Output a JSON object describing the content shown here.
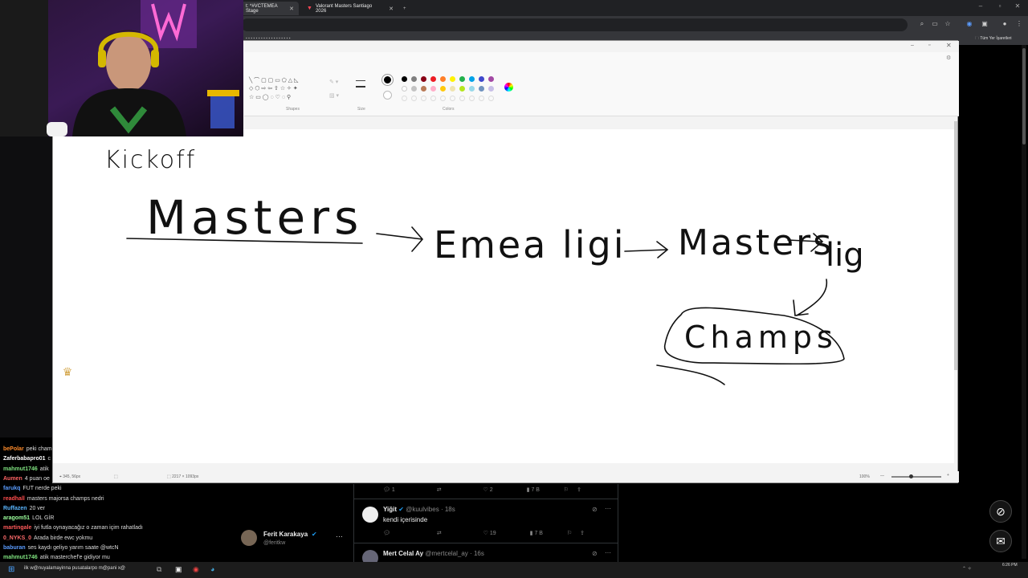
{
  "browser": {
    "tabs": [
      {
        "label": "t: *#VCTEMEA Stage",
        "active": true
      },
      {
        "label": "Valorant Masters Santiago 2026",
        "active": false
      }
    ],
    "bookmarks_right": "Tüm Yer İşaretleri"
  },
  "paint": {
    "ribbon_labels": {
      "shapes": "Shapes",
      "size": "Size",
      "colors": "Colors"
    },
    "status": {
      "cursor": "345, 56px",
      "canvas_size": "2217 × 1093px",
      "zoom": "100%"
    },
    "colors_row1": [
      "#000000",
      "#7f7f7f",
      "#880015",
      "#ed1c24",
      "#ff7f27",
      "#fff200",
      "#22b14c",
      "#00a2e8",
      "#3f48cc",
      "#a349a4"
    ],
    "colors_row2": [
      "#ffffff",
      "#c3c3c3",
      "#b97a57",
      "#ffaec9",
      "#ffc90e",
      "#efe4b0",
      "#b5e61d",
      "#99d9ea",
      "#7092be",
      "#c8bfe7"
    ],
    "drawing_text": {
      "kickoff": "Kickoff",
      "masters": "Masters",
      "emea_ligi": "Emea ligi",
      "masters2": "Masters",
      "lig": "lig",
      "champs": "Champs"
    }
  },
  "chat": {
    "messages": [
      {
        "user": "bePolar",
        "color": "#ff8c2b",
        "text": "peki cham"
      },
      {
        "user": "Zaferbabapro01",
        "color": "#ffffff",
        "text": "c"
      },
      {
        "user": "mahmut1746",
        "color": "#7ee07e",
        "text": "atik"
      },
      {
        "user": "Aumen",
        "color": "#ff6464",
        "text": "4 puan oe"
      },
      {
        "user": "farukq",
        "color": "#5b9cff",
        "text": "FUT nerde peki"
      },
      {
        "user": "readhall",
        "color": "#ff4d4d",
        "text": "masters majorsa champs nedri"
      },
      {
        "user": "Ruffazen",
        "color": "#5bb6ff",
        "text": "20 ver"
      },
      {
        "user": "aragom51",
        "color": "#9cff9c",
        "text": "LOL GİR"
      },
      {
        "user": "martingale",
        "color": "#ff5a5a",
        "text": "iyi futla oynayacağız o zaman içim rahatladı"
      },
      {
        "user": "0_NYKS_0",
        "color": "#ff6b6b",
        "text": "Arada birde ewc yokmu"
      },
      {
        "user": "baburan",
        "color": "#5b9cff",
        "text": "ses kaydı geliyo yarım saate @wtcN"
      },
      {
        "user": "mahmut1746",
        "color": "#7ee07e",
        "text": "atik masterchef'e gidiyor mu"
      }
    ],
    "input_text": "ilk w@nuyalamayinna pusatalarpo m@pani x@"
  },
  "twitter": {
    "stats1": {
      "replies": "1",
      "likes": "2",
      "views": "7 B"
    },
    "tweet1": {
      "name": "Yiğit",
      "handle": "@kuulvibes",
      "time": "18s",
      "text": "kendi içerisinde"
    },
    "stats2": {
      "likes": "19",
      "views": "7 B"
    },
    "tweet2": {
      "name": "Mert Celal Ay",
      "handle": "@mertcelal_ay",
      "time": "16s"
    }
  },
  "profile": {
    "name": "Ferit Karakaya",
    "handle": "@feritkw"
  },
  "taskbar": {
    "time": "6:26 PM"
  }
}
